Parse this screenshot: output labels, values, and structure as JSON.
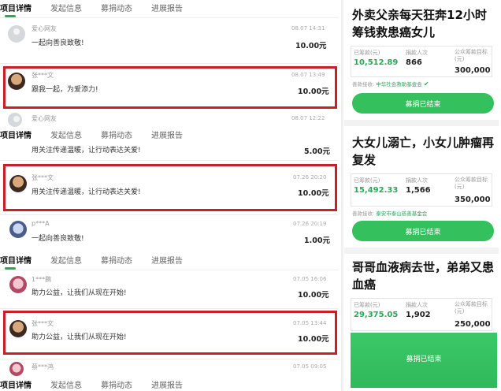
{
  "tabs": [
    "项目详情",
    "发起信息",
    "募捐动态",
    "进展报告"
  ],
  "rows": [
    {
      "donor": "爱心网友",
      "date": "08.07 14:31",
      "message": "一起向善良致敬!",
      "amount": "10.00元"
    },
    {
      "donor": "张***文",
      "date": "08.07 13:49",
      "message": "跟我一起，为爱添力!",
      "amount": "10.00元"
    },
    {
      "donor": "爱心网友",
      "date": "08.07 12:22",
      "message": "",
      "amount": ""
    },
    {
      "donor": "",
      "date": "",
      "message": "用关注传递温暖，让行动表达关爱!",
      "amount": "5.00元"
    },
    {
      "donor": "张***文",
      "date": "07.26 20:20",
      "message": "用关注传递温暖，让行动表达关爱!",
      "amount": "10.00元"
    },
    {
      "donor": "p***A",
      "date": "07.26 20:19",
      "message": "一起向善良致敬!",
      "amount": "1.00元"
    },
    {
      "donor": "1***鹏",
      "date": "07.05 16:06",
      "message": "助力公益，让我们从现在开始!",
      "amount": "10.00元"
    },
    {
      "donor": "张***文",
      "date": "07.05 13:44",
      "message": "助力公益，让我们从现在开始!",
      "amount": "10.00元"
    },
    {
      "donor": "蔡***鸿",
      "date": "07.05 09:05",
      "message": "",
      "amount": ""
    }
  ],
  "cards": [
    {
      "title": "外卖父亲每天狂奔12小时筹钱救患癌女儿",
      "raised_label": "已筹款(元)",
      "raised": "10,512.89",
      "donors_label": "捐款人次",
      "donors": "866",
      "goal_label": "公众筹款目标(元)",
      "goal": "300,000",
      "org_label": "善款接收:",
      "org": "中华社会救助基金会",
      "button": "募捐已结束"
    },
    {
      "title": "大女儿溺亡，小女儿肿瘤再复发",
      "raised_label": "已筹款(元)",
      "raised": "15,492.33",
      "donors_label": "捐款人次",
      "donors": "1,566",
      "goal_label": "公众筹款目标(元)",
      "goal": "350,000",
      "org_label": "善款接收:",
      "org": "泰安市泰山慈善基金会",
      "button": "募捐已结束"
    },
    {
      "title": "哥哥血液病去世，弟弟又患血癌",
      "raised_label": "已筹款(元)",
      "raised": "29,375.05",
      "donors_label": "捐款人次",
      "donors": "1,902",
      "goal_label": "公众筹款目标(元)",
      "goal": "250,000",
      "button": "募捐已结束"
    }
  ],
  "colors": {
    "accent": "#34c05c",
    "highlight": "#c8202a"
  }
}
